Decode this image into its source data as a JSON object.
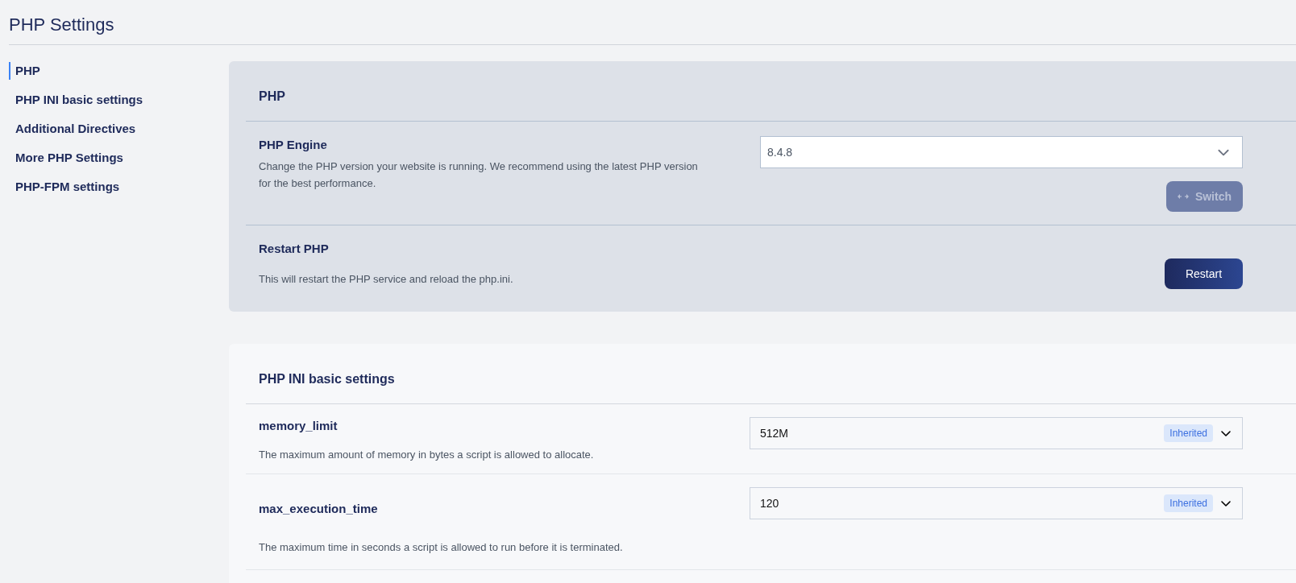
{
  "page_title": "PHP Settings",
  "sidebar": {
    "items": [
      {
        "label": "PHP",
        "selected": true
      },
      {
        "label": "PHP INI basic settings",
        "selected": false
      },
      {
        "label": "Additional Directives",
        "selected": false
      },
      {
        "label": "More PHP Settings",
        "selected": false
      },
      {
        "label": "PHP-FPM settings",
        "selected": false
      }
    ]
  },
  "php_panel": {
    "title": "PHP",
    "engine": {
      "title": "PHP Engine",
      "description": "Change the PHP version your website is running. We recommend using the latest PHP version for the best performance.",
      "value": "8.4.8",
      "switch_button": {
        "label": "Switch",
        "disabled": true
      }
    },
    "restart": {
      "title": "Restart PHP",
      "description": "This will restart the PHP service and reload the php.ini.",
      "button": {
        "label": "Restart",
        "disabled": false
      }
    }
  },
  "ini_panel": {
    "title": "PHP INI basic settings",
    "settings": [
      {
        "name": "memory_limit",
        "description": "The maximum amount of memory in bytes a script is allowed to allocate.",
        "value": "512M",
        "badge": "Inherited"
      },
      {
        "name": "max_execution_time",
        "description": "The maximum time in seconds a script is allowed to run before it is terminated.",
        "value": "120",
        "badge": "Inherited"
      }
    ]
  }
}
